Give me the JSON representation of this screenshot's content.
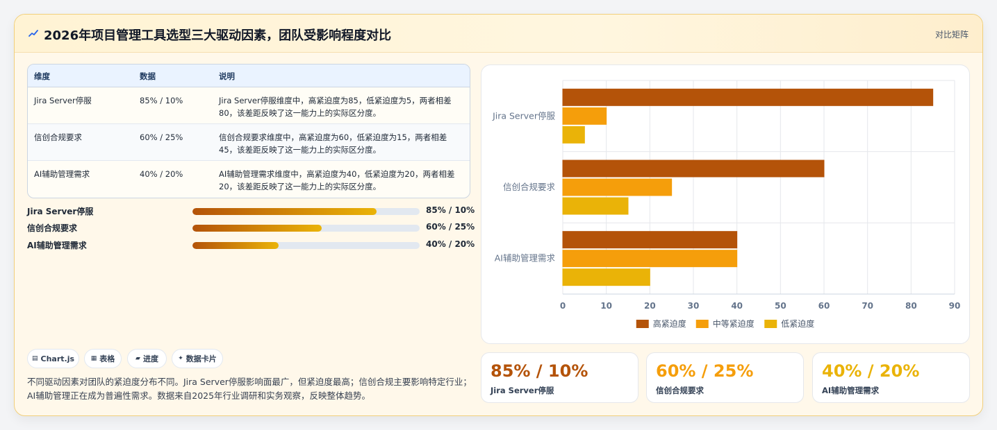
{
  "header": {
    "title": "2026年项目管理工具选型三大驱动因素，团队受影响程度对比",
    "matrix_label": "对比矩阵"
  },
  "colors": {
    "high": "#b45309",
    "medium": "#f59e0b",
    "low": "#eab308"
  },
  "table": {
    "headers": [
      "维度",
      "数据",
      "说明"
    ],
    "rows": [
      {
        "dim": "Jira Server停服",
        "data": "85% / 10%",
        "desc": "Jira Server停服维度中，高紧迫度为85，低紧迫度为5，两者相差80，该差距反映了这一能力上的实际区分度。"
      },
      {
        "dim": "信创合规要求",
        "data": "60% / 25%",
        "desc": "信创合规要求维度中，高紧迫度为60，低紧迫度为15，两者相差45，该差距反映了这一能力上的实际区分度。"
      },
      {
        "dim": "AI辅助管理需求",
        "data": "40% / 20%",
        "desc": "AI辅助管理需求维度中，高紧迫度为40，低紧迫度为20，两者相差20，该差距反映了这一能力上的实际区分度。"
      }
    ]
  },
  "progress": [
    {
      "label": "Jira Server停服",
      "value": "85% / 10%",
      "fraction": 0.81
    },
    {
      "label": "信创合规要求",
      "value": "60% / 25%",
      "fraction": 0.57
    },
    {
      "label": "AI辅助管理需求",
      "value": "40% / 20%",
      "fraction": 0.38
    }
  ],
  "chips": [
    {
      "icon": "▤",
      "label": "Chart.js"
    },
    {
      "icon": "▦",
      "label": "表格"
    },
    {
      "icon": "▰",
      "label": "进度"
    },
    {
      "icon": "✦",
      "label": "数据卡片"
    }
  ],
  "note": "不同驱动因素对团队的紧迫度分布不同。Jira Server停服影响面最广，但紧迫度最高；信创合规主要影响特定行业；AI辅助管理正在成为普遍性需求。数据来自2025年行业调研和实务观察，反映整体趋势。",
  "stats": [
    {
      "value": "85% / 10%",
      "label": "Jira Server停服",
      "color": "#b45309"
    },
    {
      "value": "60% / 25%",
      "label": "信创合规要求",
      "color": "#f59e0b"
    },
    {
      "value": "40% / 20%",
      "label": "AI辅助管理需求",
      "color": "#eab308"
    }
  ],
  "chart_data": {
    "type": "bar",
    "orientation": "horizontal",
    "categories": [
      "Jira Server停服",
      "信创合规要求",
      "AI辅助管理需求"
    ],
    "series": [
      {
        "name": "高紧迫度",
        "values": [
          85,
          60,
          40
        ],
        "color": "#b45309"
      },
      {
        "name": "中等紧迫度",
        "values": [
          10,
          25,
          40
        ],
        "color": "#f59e0b"
      },
      {
        "name": "低紧迫度",
        "values": [
          5,
          15,
          20
        ],
        "color": "#eab308"
      }
    ],
    "xlim": [
      0,
      90
    ],
    "xticks": [
      0,
      10,
      20,
      30,
      40,
      50,
      60,
      70,
      80,
      90
    ],
    "grid": true,
    "legend": "bottom"
  }
}
